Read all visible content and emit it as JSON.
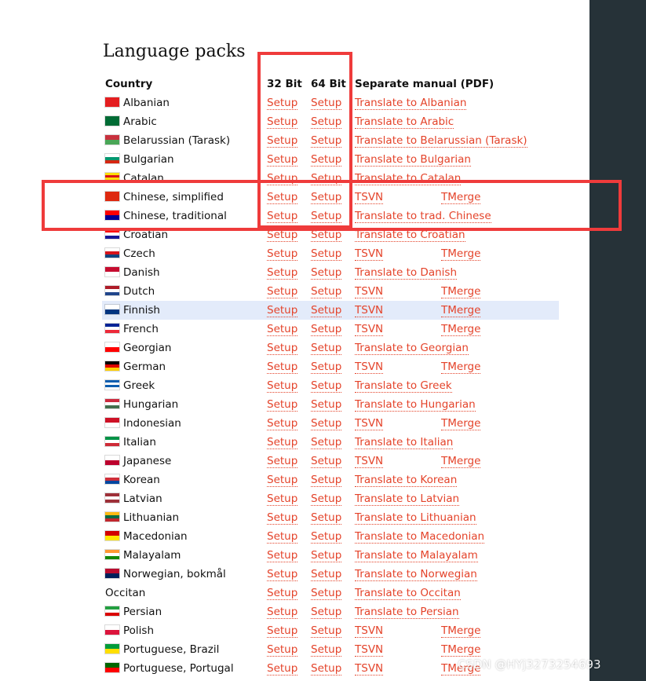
{
  "page": {
    "title": "Language packs"
  },
  "columns": {
    "country": "Country",
    "bit32": "32 Bit",
    "bit64": "64 Bit",
    "manual": "Separate manual (PDF)"
  },
  "rows": [
    {
      "country": "Albanian",
      "flag": [
        "#e41e20",
        "#e41e20"
      ],
      "setup32": "Setup",
      "setup64": "Setup",
      "manual": "Translate to Albanian",
      "manual2": ""
    },
    {
      "country": "Arabic",
      "flag": [
        "#006c35",
        "#006c35"
      ],
      "setup32": "Setup",
      "setup64": "Setup",
      "manual": "Translate to Arabic",
      "manual2": ""
    },
    {
      "country": "Belarussian (Tarask)",
      "flag": [
        "#c8313e",
        "#4aa657"
      ],
      "setup32": "Setup",
      "setup64": "Setup",
      "manual": "Translate to Belarussian (Tarask)",
      "manual2": ""
    },
    {
      "country": "Bulgarian",
      "flag": [
        "#ffffff",
        "#00966e",
        "#d62612"
      ],
      "setup32": "Setup",
      "setup64": "Setup",
      "manual": "Translate to Bulgarian",
      "manual2": ""
    },
    {
      "country": "Catalan",
      "flag": [
        "#fcdd09",
        "#da121a",
        "#fcdd09",
        "#da121a"
      ],
      "setup32": "Setup",
      "setup64": "Setup",
      "manual": "Translate to Catalan",
      "manual2": ""
    },
    {
      "country": "Chinese, simplified",
      "flag": [
        "#de2910",
        "#de2910"
      ],
      "setup32": "Setup",
      "setup64": "Setup",
      "manual": "TSVN",
      "manual2": "TMerge"
    },
    {
      "country": "Chinese, traditional",
      "flag": [
        "#fe0000",
        "#000095"
      ],
      "setup32": "Setup",
      "setup64": "Setup",
      "manual": "Translate to trad. Chinese",
      "manual2": ""
    },
    {
      "country": "Croatian",
      "flag": [
        "#ff0000",
        "#ffffff",
        "#171796"
      ],
      "setup32": "Setup",
      "setup64": "Setup",
      "manual": "Translate to Croatian",
      "manual2": ""
    },
    {
      "country": "Czech",
      "flag": [
        "#ffffff",
        "#d7141a",
        "#11457e"
      ],
      "setup32": "Setup",
      "setup64": "Setup",
      "manual": "TSVN",
      "manual2": "TMerge"
    },
    {
      "country": "Danish",
      "flag": [
        "#c60c30",
        "#ffffff"
      ],
      "setup32": "Setup",
      "setup64": "Setup",
      "manual": "Translate to Danish",
      "manual2": ""
    },
    {
      "country": "Dutch",
      "flag": [
        "#ae1c28",
        "#ffffff",
        "#21468b"
      ],
      "setup32": "Setup",
      "setup64": "Setup",
      "manual": "TSVN",
      "manual2": "TMerge"
    },
    {
      "country": "Finnish",
      "flag": [
        "#ffffff",
        "#003580"
      ],
      "setup32": "Setup",
      "setup64": "Setup",
      "manual": "TSVN",
      "manual2": "TMerge",
      "highlight": true
    },
    {
      "country": "French",
      "flag": [
        "#002395",
        "#ffffff",
        "#ed2939"
      ],
      "setup32": "Setup",
      "setup64": "Setup",
      "manual": "TSVN",
      "manual2": "TMerge"
    },
    {
      "country": "Georgian",
      "flag": [
        "#ffffff",
        "#ff0000"
      ],
      "setup32": "Setup",
      "setup64": "Setup",
      "manual": "Translate to Georgian",
      "manual2": ""
    },
    {
      "country": "German",
      "flag": [
        "#000000",
        "#dd0000",
        "#ffce00"
      ],
      "setup32": "Setup",
      "setup64": "Setup",
      "manual": "TSVN",
      "manual2": "TMerge"
    },
    {
      "country": "Greek",
      "flag": [
        "#0d5eaf",
        "#ffffff",
        "#0d5eaf",
        "#ffffff"
      ],
      "setup32": "Setup",
      "setup64": "Setup",
      "manual": "Translate to Greek",
      "manual2": ""
    },
    {
      "country": "Hungarian",
      "flag": [
        "#cd2a3e",
        "#ffffff",
        "#436f4d"
      ],
      "setup32": "Setup",
      "setup64": "Setup",
      "manual": "Translate to Hungarian",
      "manual2": ""
    },
    {
      "country": "Indonesian",
      "flag": [
        "#ce1126",
        "#ffffff"
      ],
      "setup32": "Setup",
      "setup64": "Setup",
      "manual": "TSVN",
      "manual2": "TMerge"
    },
    {
      "country": "Italian",
      "flag": [
        "#009246",
        "#ffffff",
        "#ce2b37"
      ],
      "setup32": "Setup",
      "setup64": "Setup",
      "manual": "Translate to Italian",
      "manual2": ""
    },
    {
      "country": "Japanese",
      "flag": [
        "#ffffff",
        "#bc002d"
      ],
      "setup32": "Setup",
      "setup64": "Setup",
      "manual": "TSVN",
      "manual2": "TMerge"
    },
    {
      "country": "Korean",
      "flag": [
        "#ffffff",
        "#cd2e3a",
        "#0047a0"
      ],
      "setup32": "Setup",
      "setup64": "Setup",
      "manual": "Translate to Korean",
      "manual2": ""
    },
    {
      "country": "Latvian",
      "flag": [
        "#9e3039",
        "#ffffff",
        "#9e3039"
      ],
      "setup32": "Setup",
      "setup64": "Setup",
      "manual": "Translate to Latvian",
      "manual2": ""
    },
    {
      "country": "Lithuanian",
      "flag": [
        "#fdb913",
        "#006a44",
        "#c1272d"
      ],
      "setup32": "Setup",
      "setup64": "Setup",
      "manual": "Translate to Lithuanian",
      "manual2": ""
    },
    {
      "country": "Macedonian",
      "flag": [
        "#d20000",
        "#ffe600"
      ],
      "setup32": "Setup",
      "setup64": "Setup",
      "manual": "Translate to Macedonian",
      "manual2": ""
    },
    {
      "country": "Malayalam",
      "flag": [
        "#ff9933",
        "#ffffff",
        "#138808"
      ],
      "setup32": "Setup",
      "setup64": "Setup",
      "manual": "Translate to Malayalam",
      "manual2": ""
    },
    {
      "country": "Norwegian, bokmål",
      "flag": [
        "#ba0c2f",
        "#00205b"
      ],
      "setup32": "Setup",
      "setup64": "Setup",
      "manual": "Translate to Norwegian",
      "manual2": ""
    },
    {
      "country": "Occitan",
      "flag": [],
      "setup32": "Setup",
      "setup64": "Setup",
      "manual": "Translate to Occitan",
      "manual2": ""
    },
    {
      "country": "Persian",
      "flag": [
        "#239f40",
        "#ffffff",
        "#da0000"
      ],
      "setup32": "Setup",
      "setup64": "Setup",
      "manual": "Translate to Persian",
      "manual2": ""
    },
    {
      "country": "Polish",
      "flag": [
        "#ffffff",
        "#dc143c"
      ],
      "setup32": "Setup",
      "setup64": "Setup",
      "manual": "TSVN",
      "manual2": "TMerge"
    },
    {
      "country": "Portuguese, Brazil",
      "flag": [
        "#009c3b",
        "#ffdf00"
      ],
      "setup32": "Setup",
      "setup64": "Setup",
      "manual": "TSVN",
      "manual2": "TMerge"
    },
    {
      "country": "Portuguese, Portugal",
      "flag": [
        "#006600",
        "#ff0000"
      ],
      "setup32": "Setup",
      "setup64": "Setup",
      "manual": "TSVN",
      "manual2": "TMerge"
    }
  ],
  "watermark": "CSDN @HYj3273254693",
  "colors": {
    "link": "#e4432a",
    "annotation_box": "#ef3b3b",
    "sidebar": "#263238",
    "row_highlight": "#e3ebfa"
  }
}
